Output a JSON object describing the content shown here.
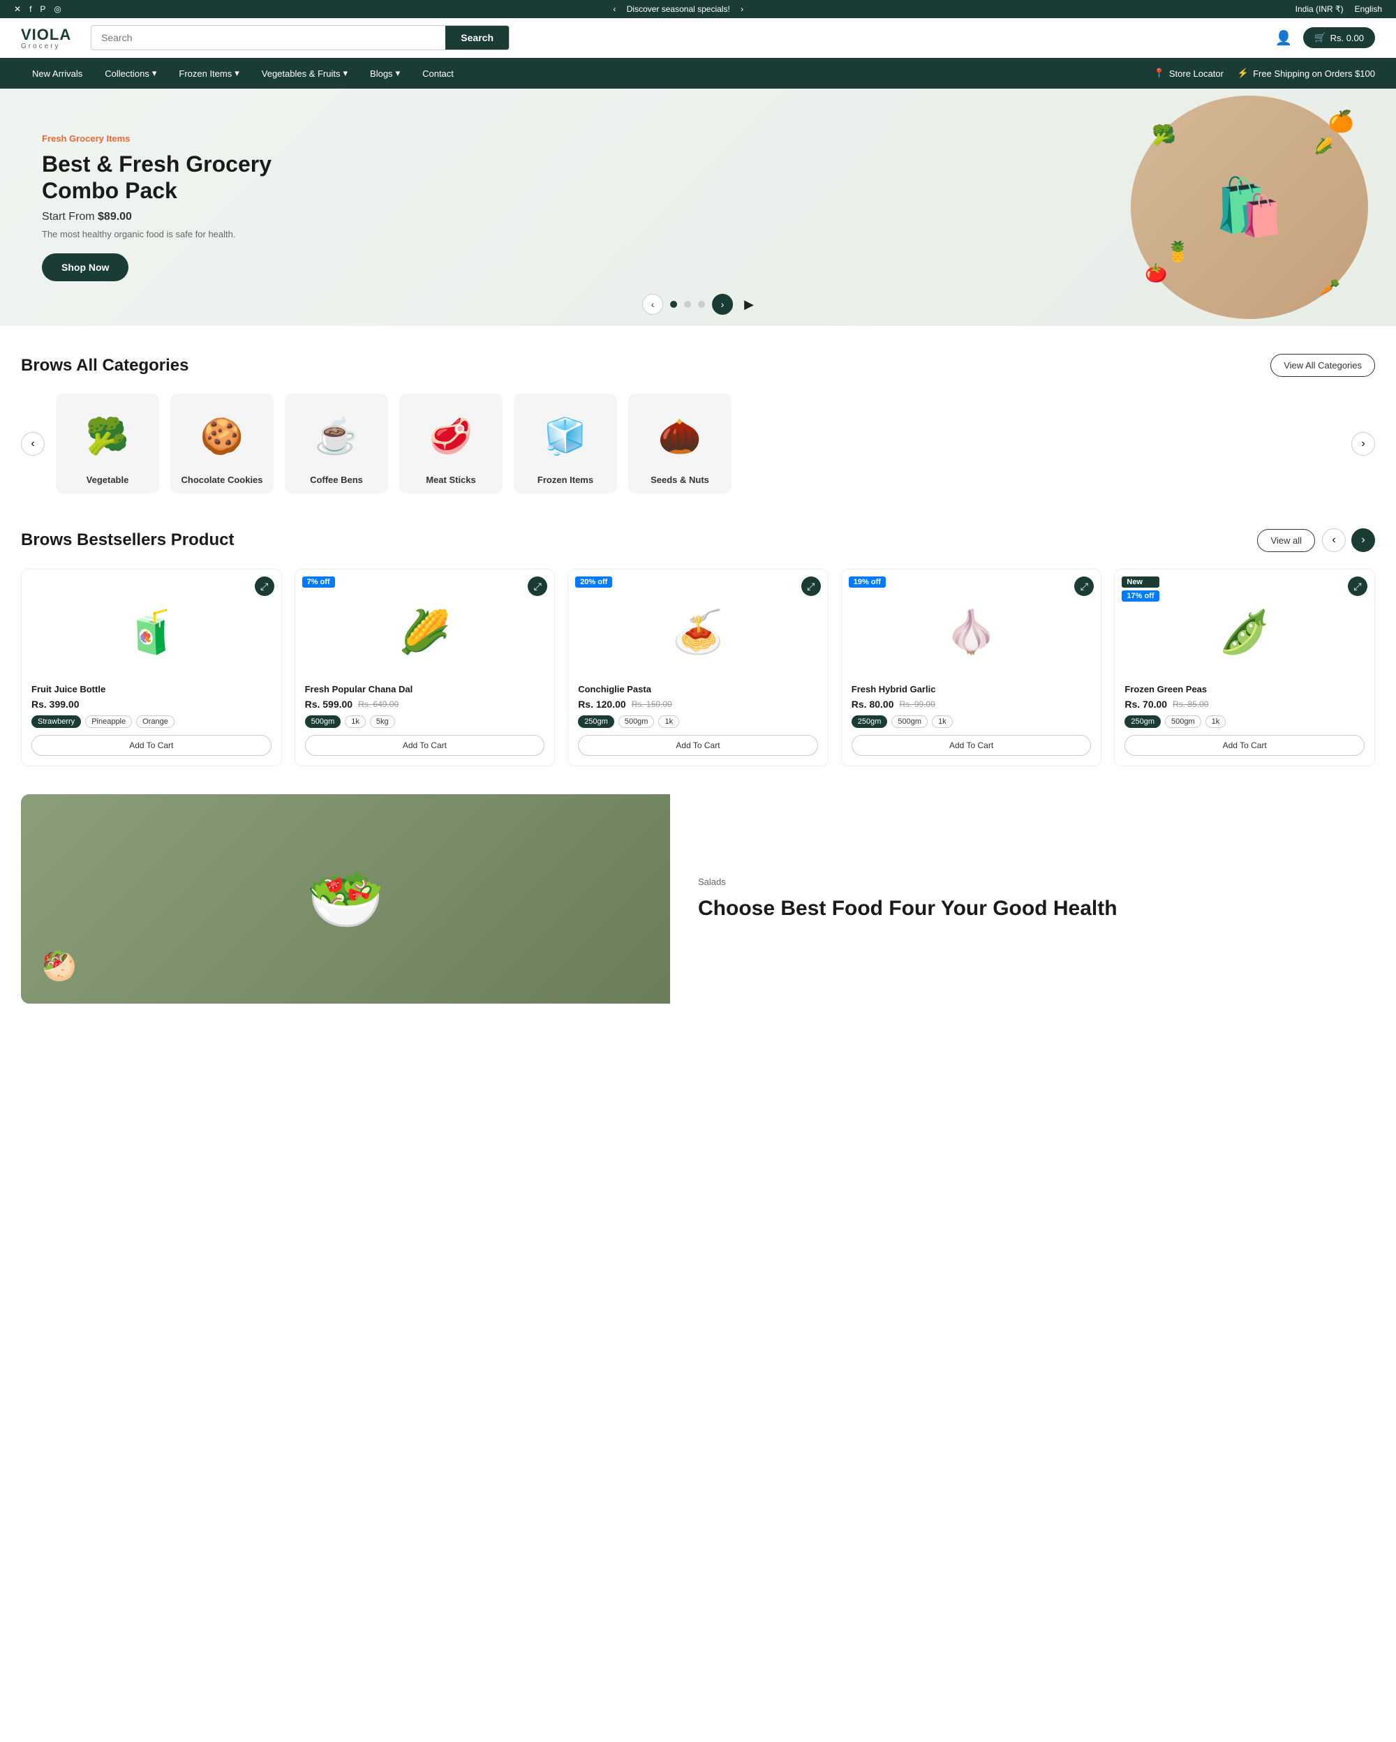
{
  "topBar": {
    "announcement": "Discover seasonal specials!",
    "region": "India (INR ₹)",
    "language": "English",
    "social": [
      "✕",
      "f",
      "𝐏",
      "📷"
    ]
  },
  "header": {
    "logo": "VIOLA",
    "logoSub": "Grocery",
    "searchPlaceholder": "Search",
    "searchButton": "Search",
    "cartLabel": "Rs. 0.00"
  },
  "nav": {
    "items": [
      {
        "label": "New Arrivals",
        "hasDropdown": false
      },
      {
        "label": "Collections",
        "hasDropdown": true
      },
      {
        "label": "Frozen Items",
        "hasDropdown": true
      },
      {
        "label": "Vegetables & Fruits",
        "hasDropdown": true
      },
      {
        "label": "Blogs",
        "hasDropdown": true
      },
      {
        "label": "Contact",
        "hasDropdown": false
      }
    ],
    "right": [
      {
        "label": "Store Locator",
        "icon": "📍"
      },
      {
        "label": "Free Shipping on Orders $100",
        "icon": "⚡"
      }
    ]
  },
  "hero": {
    "tag": "Fresh Grocery Items",
    "title": "Best & Fresh Grocery Combo Pack",
    "priceLabel": "Start From",
    "price": "$89.00",
    "description": "The most healthy organic food is safe for health.",
    "shopNowLabel": "Shop Now",
    "dots": [
      true,
      false,
      false
    ]
  },
  "categories": {
    "sectionTitle": "Brows All Categories",
    "viewAllLabel": "View All Categories",
    "items": [
      {
        "name": "Vegetable",
        "emoji": "🥦"
      },
      {
        "name": "Chocolate Cookies",
        "emoji": "🍪"
      },
      {
        "name": "Coffee Bens",
        "emoji": "☕"
      },
      {
        "name": "Meat Sticks",
        "emoji": "🥩"
      },
      {
        "name": "Frozen Items",
        "emoji": "🧊"
      },
      {
        "name": "Seeds & Nuts",
        "emoji": "🌰"
      }
    ]
  },
  "bestsellers": {
    "sectionTitle": "Brows Bestsellers Product",
    "viewAllLabel": "View all",
    "products": [
      {
        "name": "Fruit Juice Bottle",
        "price": "Rs. 399.00",
        "oldPrice": "",
        "badge": "",
        "badgeNew": false,
        "discount": "",
        "emoji": "🧃",
        "variants": [
          "Strawberry",
          "Pineapple",
          "Orange"
        ],
        "activeVariant": 0,
        "addToCart": "Add To Cart"
      },
      {
        "name": "Fresh Popular Chana Dal",
        "price": "Rs. 599.00",
        "oldPrice": "Rs. 649.00",
        "badge": "7% off",
        "badgeNew": false,
        "discount": "7% off",
        "emoji": "🌽",
        "variants": [
          "500gm",
          "1k",
          "5kg"
        ],
        "activeVariant": 0,
        "addToCart": "Add To Cart"
      },
      {
        "name": "Conchiglie Pasta",
        "price": "Rs. 120.00",
        "oldPrice": "Rs. 150.00",
        "badge": "20% off",
        "badgeNew": false,
        "discount": "20% off",
        "emoji": "🍝",
        "variants": [
          "250gm",
          "500gm",
          "1k"
        ],
        "activeVariant": 0,
        "addToCart": "Add To Cart"
      },
      {
        "name": "Fresh Hybrid Garlic",
        "price": "Rs. 80.00",
        "oldPrice": "Rs. 99.00",
        "badge": "19% off",
        "badgeNew": false,
        "discount": "19% off",
        "emoji": "🧄",
        "variants": [
          "250gm",
          "500gm",
          "1k"
        ],
        "activeVariant": 0,
        "addToCart": "Add To Cart"
      },
      {
        "name": "Frozen Green Peas",
        "price": "Rs. 70.00",
        "oldPrice": "Rs. 85.00",
        "badge": "New",
        "badgeNew": true,
        "discount": "17% off",
        "emoji": "🫛",
        "variants": [
          "250gm",
          "500gm",
          "1k"
        ],
        "activeVariant": 0,
        "addToCart": "Add To Cart"
      }
    ]
  },
  "promo": {
    "tag": "Salads",
    "title": "Choose Best Food Four Your Good Health",
    "emoji": "🥗"
  }
}
